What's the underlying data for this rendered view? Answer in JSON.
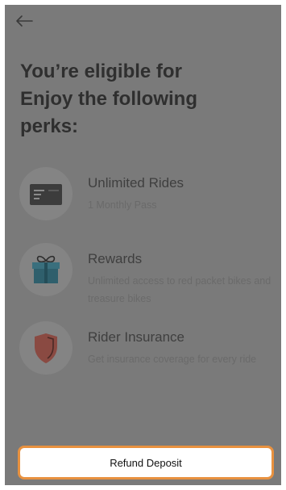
{
  "header": {
    "back_icon": "arrow-left-icon"
  },
  "headline": {
    "line1": "You’re eligible for",
    "line2": "Enjoy the following",
    "line3": "perks:"
  },
  "perks": [
    {
      "icon": "pass-card-icon",
      "title": "Unlimited Rides",
      "description": "1 Monthly Pass"
    },
    {
      "icon": "gift-box-icon",
      "title": "Rewards",
      "description": "Unlimited access to red packet bikes and treasure bikes"
    },
    {
      "icon": "shield-icon",
      "title": "Rider Insurance",
      "description": "Get insurance coverage for every ride"
    }
  ],
  "footer": {
    "refund_label": "Refund Deposit"
  },
  "colors": {
    "overlay": "#7a7a7a",
    "accent_border": "#e8913f",
    "gift_teal": "#2f5f6c",
    "shield_red": "#8a4a42"
  }
}
